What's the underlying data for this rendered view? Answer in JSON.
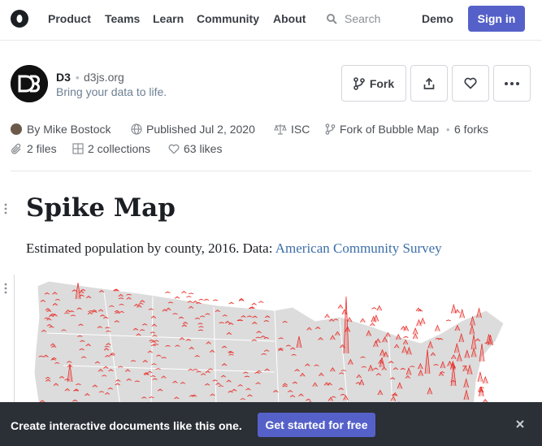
{
  "nav": {
    "links": [
      "Product",
      "Teams",
      "Learn",
      "Community",
      "About"
    ],
    "search_placeholder": "Search",
    "demo_label": "Demo",
    "signin_label": "Sign in"
  },
  "header": {
    "owner": "D3",
    "domain": "d3js.org",
    "tagline": "Bring your data to life.",
    "fork_label": "Fork"
  },
  "meta": {
    "author": "By Mike Bostock",
    "published": "Published Jul 2, 2020",
    "license": "ISC",
    "fork_of": "Fork of Bubble Map",
    "forks": "6 forks",
    "files": "2 files",
    "collections": "2 collections",
    "likes": "63 likes"
  },
  "notebook": {
    "title": "Spike Map",
    "description": "Estimated population by county, 2016. Data: ",
    "source_link": "American Community Survey"
  },
  "banner": {
    "text": "Create interactive documents like this one.",
    "cta_label": "Get started for free"
  },
  "colors": {
    "accent": "#5561c9",
    "spike": "#e8211b",
    "map_fill": "#dcdcdc",
    "banner_bg": "#2b2f36"
  }
}
